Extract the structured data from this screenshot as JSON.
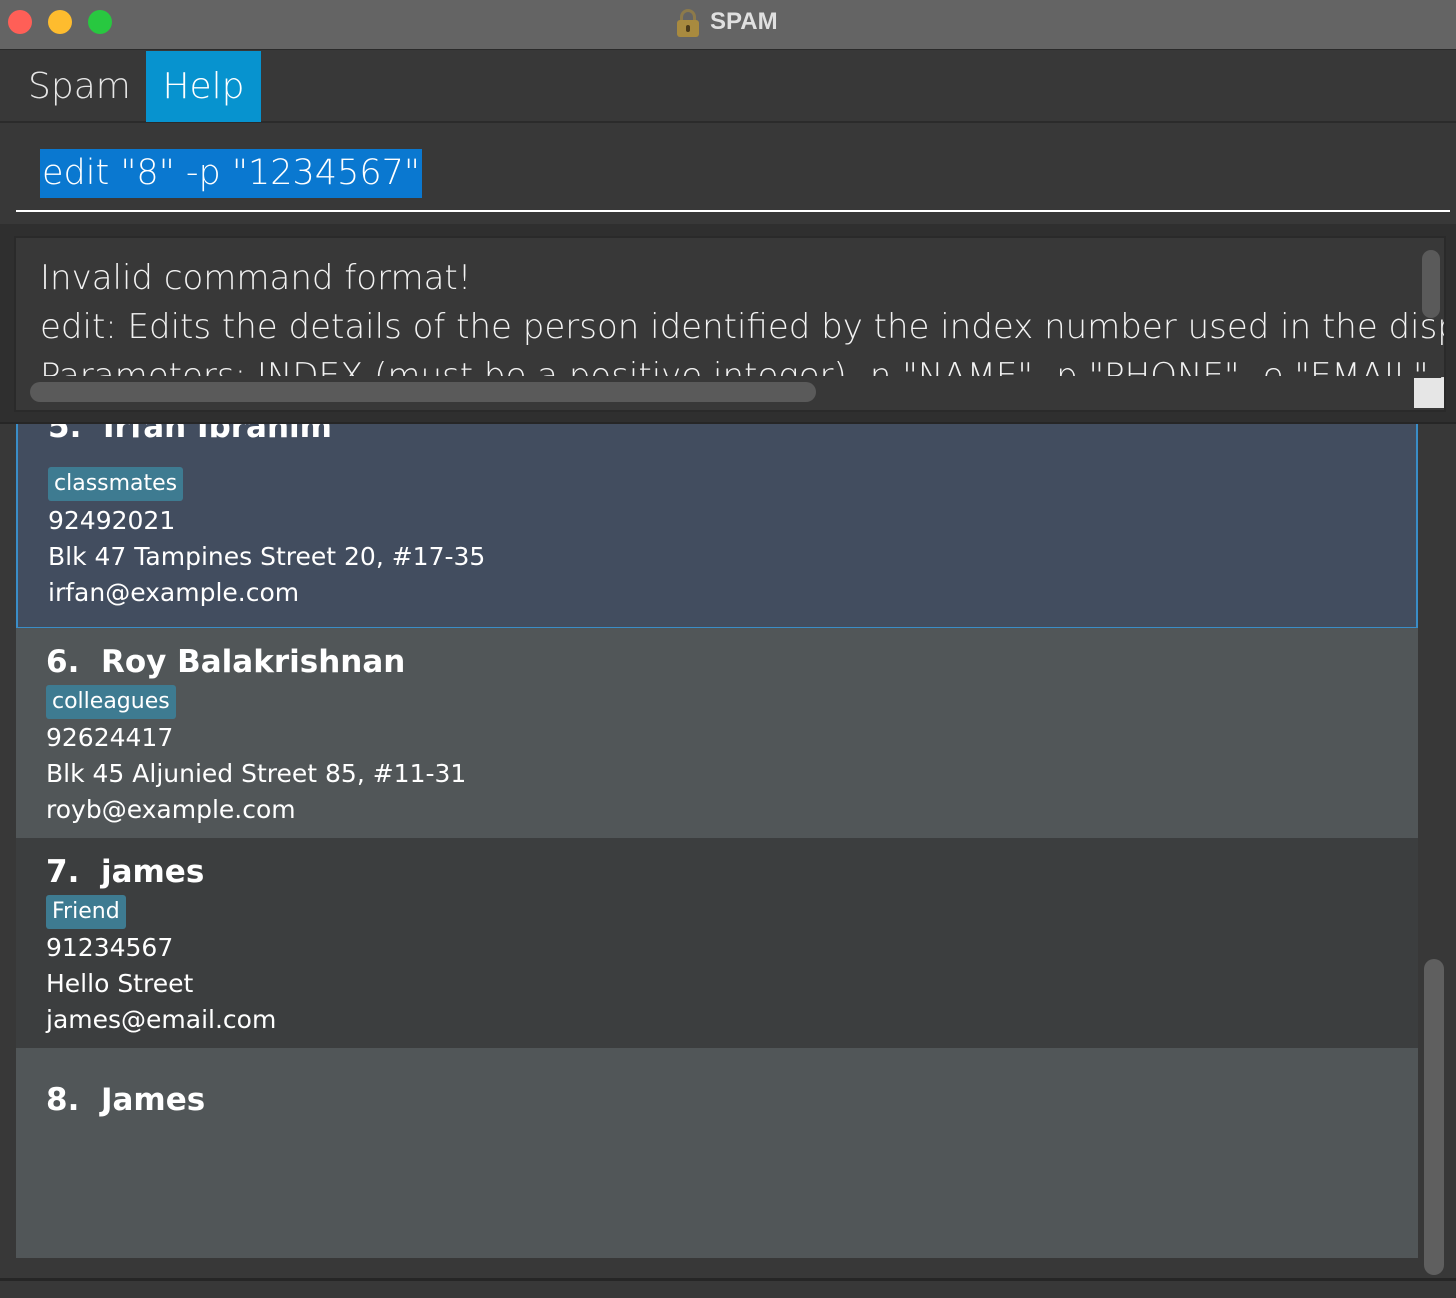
{
  "window": {
    "title": "SPAM"
  },
  "menu": {
    "items": [
      "Spam",
      "Help"
    ]
  },
  "command": {
    "value": "edit \"8\" -p \"1234567\""
  },
  "result": {
    "lines": [
      "Invalid command format!",
      "edit: Edits the details of the person identified by the index number used in the displayed",
      "Parameters: INDEX (must be a positive integer) -n \"NAME\" -p \"PHONE\" -e \"EMAIL\" -a \"ADD"
    ]
  },
  "persons": [
    {
      "index": "5.",
      "name": "Irfan Ibrahim",
      "tag": "classmates",
      "phone": "92492021",
      "address": "Blk 47 Tampines Street 20, #17-35",
      "email": "irfan@example.com"
    },
    {
      "index": "6.",
      "name": "Roy Balakrishnan",
      "tag": "colleagues",
      "phone": "92624417",
      "address": "Blk 45 Aljunied Street 85, #11-31",
      "email": "royb@example.com"
    },
    {
      "index": "7.",
      "name": "james",
      "tag": "Friend",
      "phone": "91234567",
      "address": "Hello Street",
      "email": "james@email.com"
    },
    {
      "index": "8.",
      "name": "James"
    }
  ]
}
